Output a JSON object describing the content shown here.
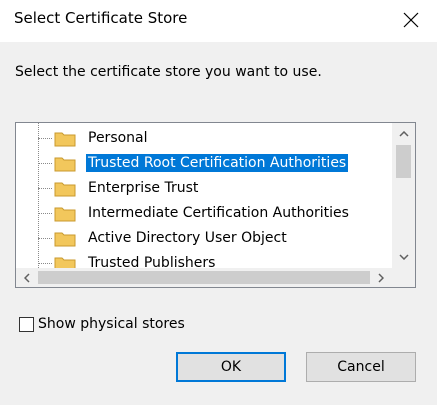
{
  "dialog": {
    "title": "Select Certificate Store",
    "instruction": "Select the certificate store you want to use."
  },
  "tree": {
    "items": [
      {
        "label": "Personal",
        "icon": "folder-icon",
        "selected": false
      },
      {
        "label": "Trusted Root Certification Authorities",
        "icon": "folder-icon",
        "selected": true
      },
      {
        "label": "Enterprise Trust",
        "icon": "folder-icon",
        "selected": false
      },
      {
        "label": "Intermediate Certification Authorities",
        "icon": "folder-icon",
        "selected": false
      },
      {
        "label": "Active Directory User Object",
        "icon": "folder-icon",
        "selected": false
      },
      {
        "label": "Trusted Publishers",
        "icon": "folder-icon",
        "selected": false
      }
    ]
  },
  "options": {
    "show_physical_label": "Show physical stores",
    "show_physical_checked": false
  },
  "buttons": {
    "ok_label": "OK",
    "cancel_label": "Cancel"
  },
  "colors": {
    "selection": "#0078d7",
    "folder": "#f2c75c",
    "client_bg": "#f0f0f0"
  }
}
